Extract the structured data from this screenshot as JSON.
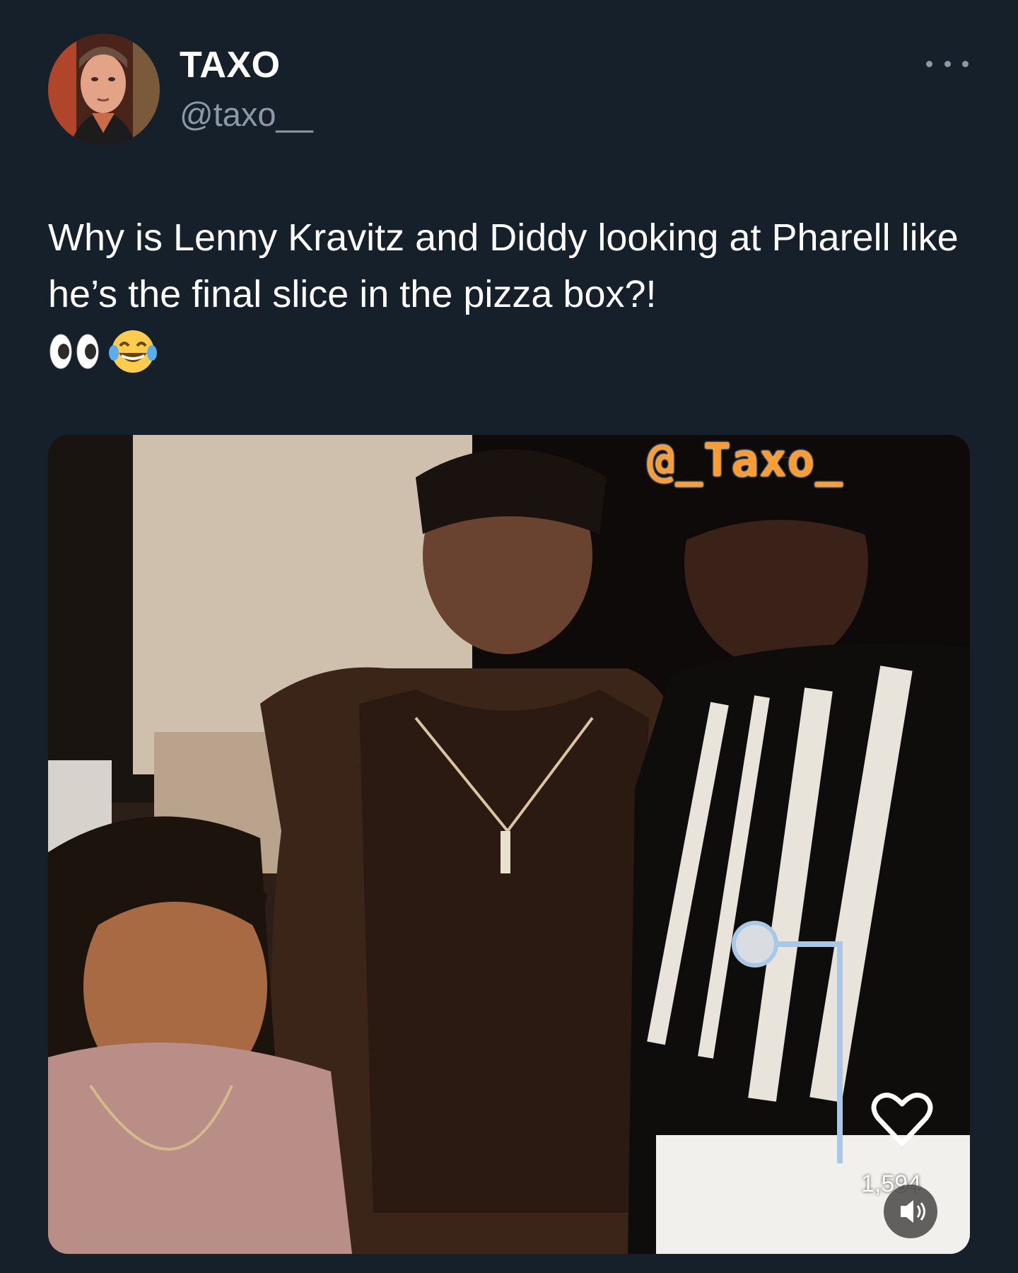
{
  "author": {
    "display_name": "TAXO",
    "handle": "@taxo__",
    "avatar_icon": "profile-photo"
  },
  "menu": {
    "icon": "more-horizontal-icon"
  },
  "tweet": {
    "text": "Why is Lenny Kravitz and Diddy looking at Pharell like he’s the final slice in the pizza box?!",
    "emojis": [
      "eyes-emoji",
      "tears-of-joy-emoji"
    ]
  },
  "media": {
    "watermark": "@_Taxo_",
    "watermark_color": "#ff9b2f",
    "like_icon": "heart-icon",
    "like_count": "1,594",
    "volume_icon": "speaker-icon"
  },
  "colors": {
    "background": "#15202b",
    "secondary_text": "#8b98a5"
  }
}
